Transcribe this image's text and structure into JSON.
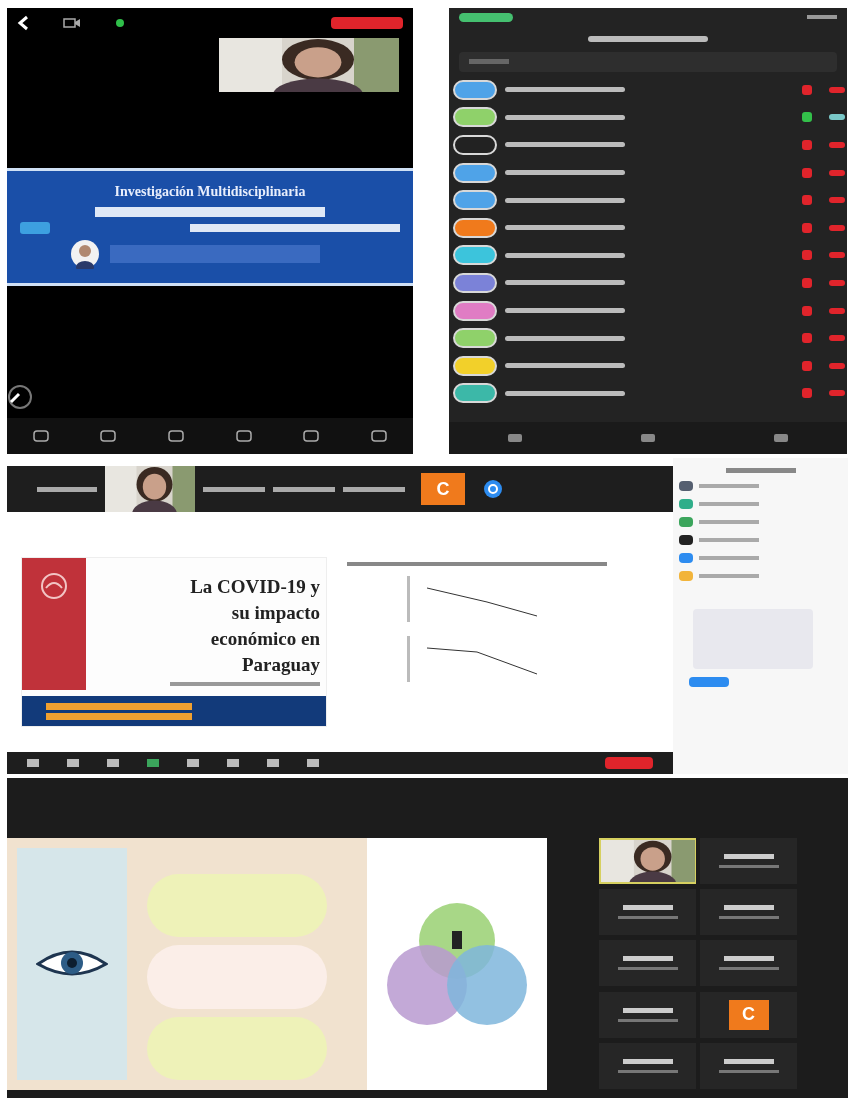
{
  "mobile_meeting": {
    "banner_title": "Investigación Multidisciplinaria"
  },
  "participants_list": {
    "participants": [
      {
        "color": "#4fa3e8",
        "muted": true
      },
      {
        "color": "#8fd16a",
        "muted": false
      },
      {
        "color": "#222222",
        "muted": true
      },
      {
        "color": "#4fa3e8",
        "muted": true
      },
      {
        "color": "#4fa3e8",
        "muted": true
      },
      {
        "color": "#f07a1c",
        "muted": true
      },
      {
        "color": "#3cc4dc",
        "muted": true
      },
      {
        "color": "#7b82d8",
        "muted": true
      },
      {
        "color": "#e07cc4",
        "muted": true
      },
      {
        "color": "#8fd16a",
        "muted": true
      },
      {
        "color": "#f2d02a",
        "muted": true
      },
      {
        "color": "#3cb8a8",
        "muted": true
      }
    ]
  },
  "desktop_meeting": {
    "top_strip_avatar": "C",
    "slide_title": "La COVID-19 y su impacto económico en Paraguay",
    "side_participants": [
      {
        "color": "#555f70"
      },
      {
        "color": "#2fae8a"
      },
      {
        "color": "#3ba55c"
      },
      {
        "color": "#222222"
      },
      {
        "color": "#2d8cf0"
      },
      {
        "color": "#f2b43a"
      }
    ]
  },
  "gallery_meeting": {
    "tile_avatar": "C"
  }
}
